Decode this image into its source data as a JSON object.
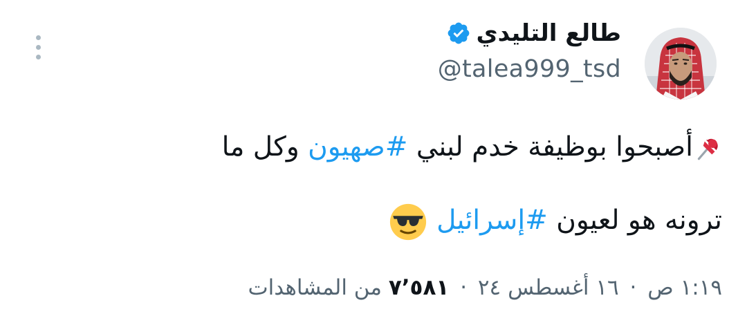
{
  "author": {
    "display_name": "طالع التليدي",
    "handle": "@talea999_tsd",
    "verified": true
  },
  "tweet": {
    "pin_emoji": "📌",
    "line1_before": "أصبحوا بوظيفة خدم لبني ",
    "hashtag1": "#صهيون",
    "line1_after": " وكل ما",
    "line2_before": "ترونه هو لعيون ",
    "hashtag2": "#إسرائيل",
    "line2_emoji": "😎"
  },
  "meta": {
    "time": "١:١٩ ص",
    "date": "١٦ أغسطس ٢٤",
    "separator": "·",
    "views_count": "٧٬٥٨١",
    "views_label": "من المشاهدات"
  },
  "colors": {
    "link": "#1d9bf0",
    "secondary_text": "#536471",
    "primary_text": "#0f1419",
    "verified_badge": "#1d9bf0"
  },
  "icons": {
    "avatar": "profile-photo",
    "verified": "verified-badge-icon",
    "more": "more-vertical-icon",
    "pin": "pushpin-emoji",
    "sunglasses": "sunglasses-face-emoji"
  }
}
